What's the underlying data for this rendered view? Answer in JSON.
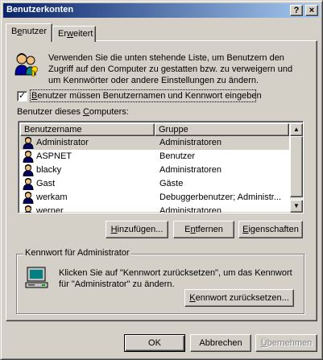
{
  "window": {
    "title": "Benutzerkonten",
    "help_button": "?",
    "close_button": "×"
  },
  "tabs": [
    {
      "label_prefix": "B",
      "label_underlined": "e",
      "label_suffix": "nutzer",
      "active": true
    },
    {
      "label_prefix": "Er",
      "label_underlined": "w",
      "label_suffix": "eitert",
      "active": false
    }
  ],
  "intro": {
    "text_line1": "Verwenden Sie die unten stehende Liste, um Benutzern den",
    "text_line2": "Zugriff auf den Computer zu gestatten bzw. zu verweigern und",
    "text_line3": "um Kennwörter oder andere Einstellungen zu ändern."
  },
  "require_password": {
    "checked": true,
    "label_prefix": "",
    "label_underlined": "B",
    "label_suffix": "enutzer müssen Benutzernamen und Kennwort eingeben"
  },
  "users_list": {
    "label_prefix": "Benutzer dieses ",
    "label_underlined": "C",
    "label_suffix": "omputers:",
    "columns": [
      "Benutzername",
      "Gruppe"
    ],
    "rows": [
      {
        "name": "Administrator",
        "group": "Administratoren",
        "selected": true
      },
      {
        "name": "ASPNET",
        "group": "Benutzer",
        "selected": false
      },
      {
        "name": "blacky",
        "group": "Administratoren",
        "selected": false
      },
      {
        "name": "Gast",
        "group": "Gäste",
        "selected": false
      },
      {
        "name": "werkam",
        "group": "Debuggerbenutzer; Administr...",
        "selected": false
      },
      {
        "name": "werner",
        "group": "Administratoren",
        "selected": false
      }
    ],
    "scroll_up": "▲",
    "scroll_down": "▼"
  },
  "list_buttons": {
    "add": {
      "prefix": "",
      "underlined": "H",
      "suffix": "inzufügen..."
    },
    "remove": {
      "prefix": "E",
      "underlined": "n",
      "suffix": "tfernen"
    },
    "properties": {
      "prefix": "",
      "underlined": "E",
      "suffix": "igenschaften"
    }
  },
  "password_group": {
    "title": "Kennwort für Administrator",
    "text_line1": "Klicken Sie auf \"Kennwort zurücksetzen\", um das Kennwort",
    "text_line2": "für \"Administrator\" zu ändern.",
    "reset_button": {
      "prefix": "",
      "underlined": "K",
      "suffix": "ennwort zurücksetzen..."
    }
  },
  "dialog_buttons": {
    "ok": "OK",
    "cancel": "Abbrechen",
    "apply": {
      "prefix": "",
      "underlined": "Ü",
      "suffix": "bernehmen",
      "enabled": false
    }
  }
}
